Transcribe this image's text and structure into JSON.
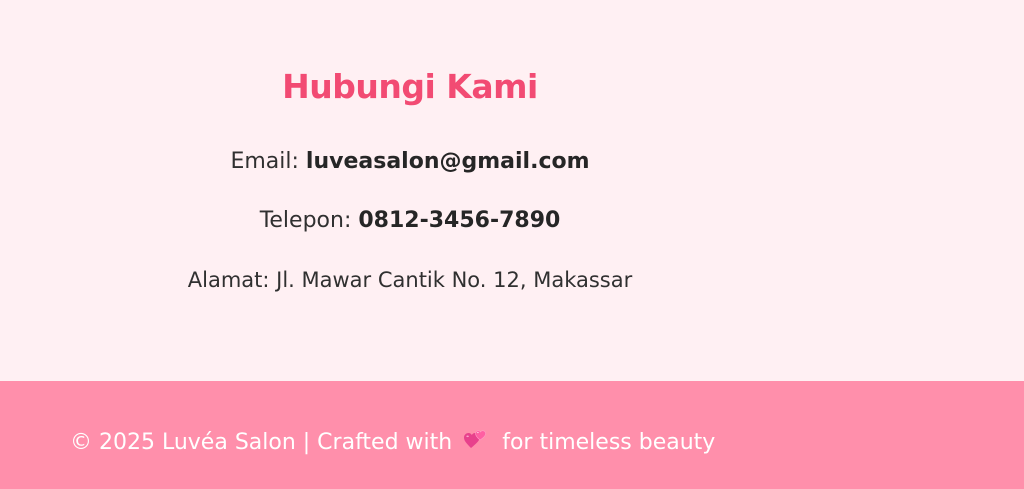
{
  "contact": {
    "title": "Hubungi Kami",
    "email_label": "Email:",
    "email_value": "luveasalon@gmail.com",
    "phone_label": "Telepon:",
    "phone_value": "0812-3456-7890",
    "address_text": "Alamat: Jl. Mawar Cantik No. 12, Makassar"
  },
  "footer": {
    "text_before": "© 2025 Luvéa Salon | Crafted with",
    "icon": "two-hearts-icon",
    "text_after": "for timeless beauty"
  },
  "colors": {
    "page_bg": "#FFF0F3",
    "title_accent": "#F24B73",
    "body_text": "#303030",
    "footer_bg": "#FF8FAB",
    "footer_text": "#FFFFFF"
  }
}
